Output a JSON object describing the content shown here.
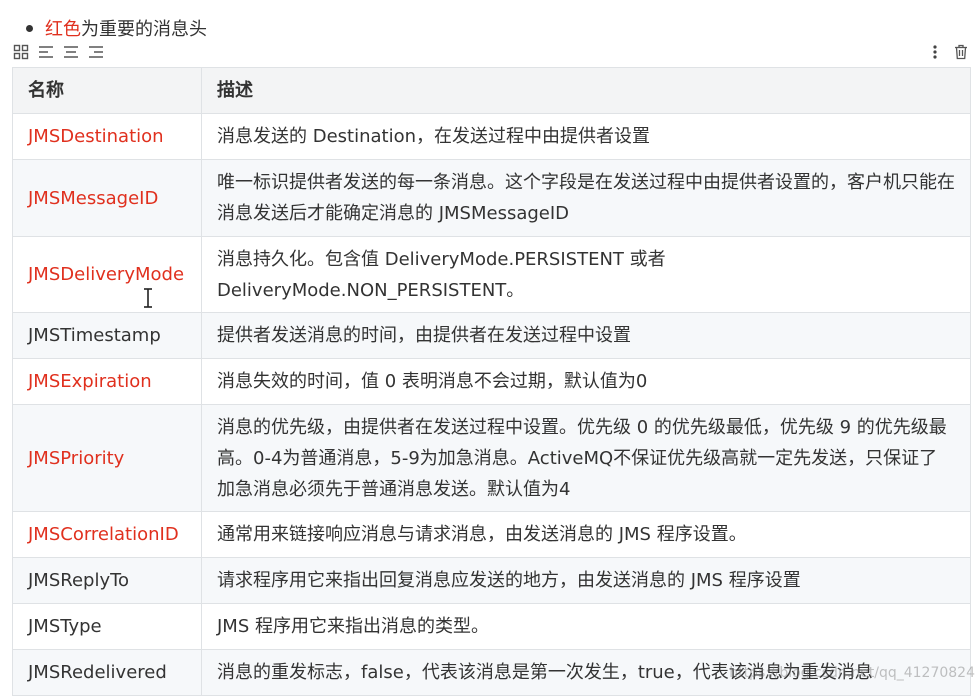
{
  "note": {
    "red_text": "红色",
    "rest_text": "为重要的消息头"
  },
  "toolbar": {
    "left_icons": [
      "grid-icon",
      "align-left-icon",
      "align-center-icon",
      "align-right-icon"
    ],
    "right_icons": [
      "more-vertical-icon",
      "trash-icon"
    ]
  },
  "table": {
    "headers": [
      "名称",
      "描述"
    ],
    "rows": [
      {
        "name": "JMSDestination",
        "important": true,
        "desc": "消息发送的 Destination，在发送过程中由提供者设置",
        "height": 46
      },
      {
        "name": "JMSMessageID",
        "important": true,
        "desc": "唯一标识提供者发送的每一条消息。这个字段是在发送过程中由提供者设置的，客户机只能在消息发送后才能确定消息的 JMSMessageID",
        "height": 77
      },
      {
        "name": "JMSDeliveryMode",
        "important": true,
        "desc": "消息持久化。包含值 DeliveryMode.PERSISTENT 或者 DeliveryMode.NON_PERSISTENT。",
        "height": 76
      },
      {
        "name": "JMSTimestamp",
        "important": false,
        "desc": "提供者发送消息的时间，由提供者在发送过程中设置",
        "height": 46
      },
      {
        "name": "JMSExpiration",
        "important": true,
        "desc": "消息失效的时间，值 0 表明消息不会过期，默认值为0",
        "height": 46
      },
      {
        "name": "JMSPriority",
        "important": true,
        "desc": "消息的优先级，由提供者在发送过程中设置。优先级 0 的优先级最低，优先级 9 的优先级最高。0-4为普通消息，5-9为加急消息。ActiveMQ不保证优先级高就一定先发送，只保证了加急消息必须先于普通消息发送。默认值为4",
        "height": 107
      },
      {
        "name": "JMSCorrelationID",
        "important": true,
        "desc": "通常用来链接响应消息与请求消息，由发送消息的 JMS 程序设置。",
        "height": 46
      },
      {
        "name": "JMSReplyTo",
        "important": false,
        "desc": "请求程序用它来指出回复消息应发送的地方，由发送消息的 JMS 程序设置",
        "height": 46
      },
      {
        "name": "JMSType",
        "important": false,
        "desc": "JMS 程序用它来指出消息的类型。",
        "height": 46
      },
      {
        "name": "JMSRedelivered",
        "important": false,
        "desc": "消息的重发标志，false，代表该消息是第一次发生，true，代表该消息为重发消息",
        "height": 46
      }
    ]
  },
  "colors": {
    "important": "#e0301e",
    "normal": "#333333",
    "header_bg": "#f3f4f5",
    "stripe_bg": "#f6f8fa",
    "border": "#dfe2e5"
  },
  "watermark": "https://blog.csdn.net/qq_41270824"
}
